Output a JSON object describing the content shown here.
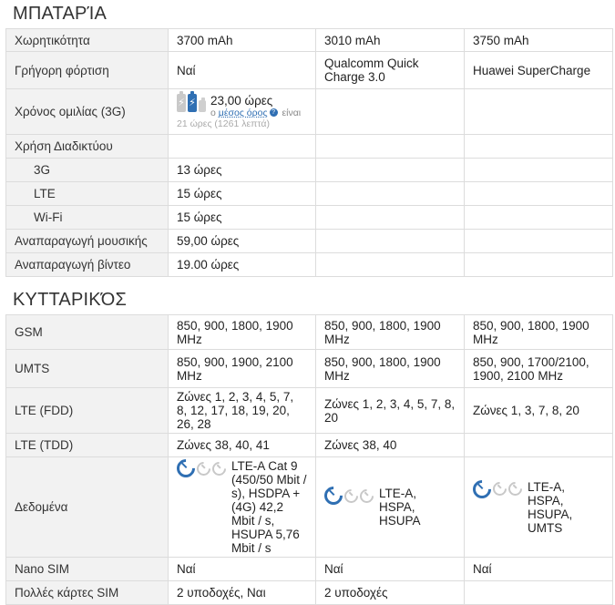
{
  "sections": {
    "battery": {
      "title": "ΜΠΑΤΑΡΊΑ",
      "rows": {
        "capacity": {
          "label": "Χωρητικότητα",
          "values": [
            "3700 mAh",
            "3010 mAh",
            "3750 mAh"
          ]
        },
        "fast_charge": {
          "label": "Γρήγορη φόρτιση",
          "values": [
            "Ναί",
            "Qualcomm Quick Charge 3.0",
            "Huawei SuperCharge"
          ]
        },
        "talk_time": {
          "label": "Χρόνος ομιλίας (3G)",
          "main": "23,00 ώρες",
          "sub_prefix": "ο",
          "sub_link": "μέσος όρος",
          "sub_suffix": "είναι",
          "sub_extra": "21 ώρες (1261 λεπτά)"
        },
        "internet": {
          "label": "Χρήση Διαδικτύου"
        },
        "3g": {
          "label": "3G",
          "values": [
            "13 ώρες",
            "",
            ""
          ]
        },
        "lte": {
          "label": "LTE",
          "values": [
            "15 ώρες",
            "",
            ""
          ]
        },
        "wifi": {
          "label": "Wi-Fi",
          "values": [
            "15 ώρες",
            "",
            ""
          ]
        },
        "music": {
          "label": "Αναπαραγωγή μουσικής",
          "values": [
            "59,00 ώρες",
            "",
            ""
          ]
        },
        "video": {
          "label": "Αναπαραγωγή βίντεο",
          "values": [
            "19.00 ώρες",
            "",
            ""
          ]
        }
      }
    },
    "cellular": {
      "title": "ΚΥΤΤΑΡΙΚΌΣ",
      "rows": {
        "gsm": {
          "label": "GSM",
          "values": [
            "850, 900, 1800, 1900 MHz",
            "850, 900, 1800, 1900 MHz",
            "850, 900, 1800, 1900 MHz"
          ]
        },
        "umts": {
          "label": "UMTS",
          "values": [
            "850, 900, 1900, 2100 MHz",
            "850, 900, 1800, 1900 MHz",
            "850, 900, 1700/2100, 1900, 2100 MHz"
          ]
        },
        "lte_fdd": {
          "label": "LTE (FDD)",
          "values": [
            "Ζώνες 1, 2, 3, 4, 5, 7, 8, 12, 17, 18, 19, 20, 26, 28",
            "Ζώνες 1, 2, 3, 4, 5, 7, 8, 20",
            "Ζώνες 1, 3, 7, 8, 20"
          ]
        },
        "lte_tdd": {
          "label": "LTE (TDD)",
          "values": [
            "Ζώνες 38, 40, 41",
            "Ζώνες 38, 40",
            ""
          ]
        },
        "data": {
          "label": "Δεδομένα",
          "values": [
            "LTE-A Cat 9 (450/50 Mbit / s), HSDPA + (4G) 42,2 Mbit / s, HSUPA 5,76 Mbit / s",
            "LTE-A, HSPA, HSUPA",
            "LTE-A, HSPA, HSUPA, UMTS"
          ]
        },
        "nano_sim": {
          "label": "Nano SIM",
          "values": [
            "Ναί",
            "Ναί",
            "Ναί"
          ]
        },
        "multi_sim": {
          "label": "Πολλές κάρτες SIM",
          "values": [
            "2 υποδοχές, Ναι",
            "2 υποδοχές",
            ""
          ]
        }
      }
    }
  },
  "icons": {
    "battery": "battery-icon",
    "speed_gauge": "speed-gauge-icon",
    "help": "question-icon"
  },
  "colors": {
    "accent": "#2f6fb3",
    "label_bg": "#f2f2f2",
    "border": "#dcdcdc"
  }
}
